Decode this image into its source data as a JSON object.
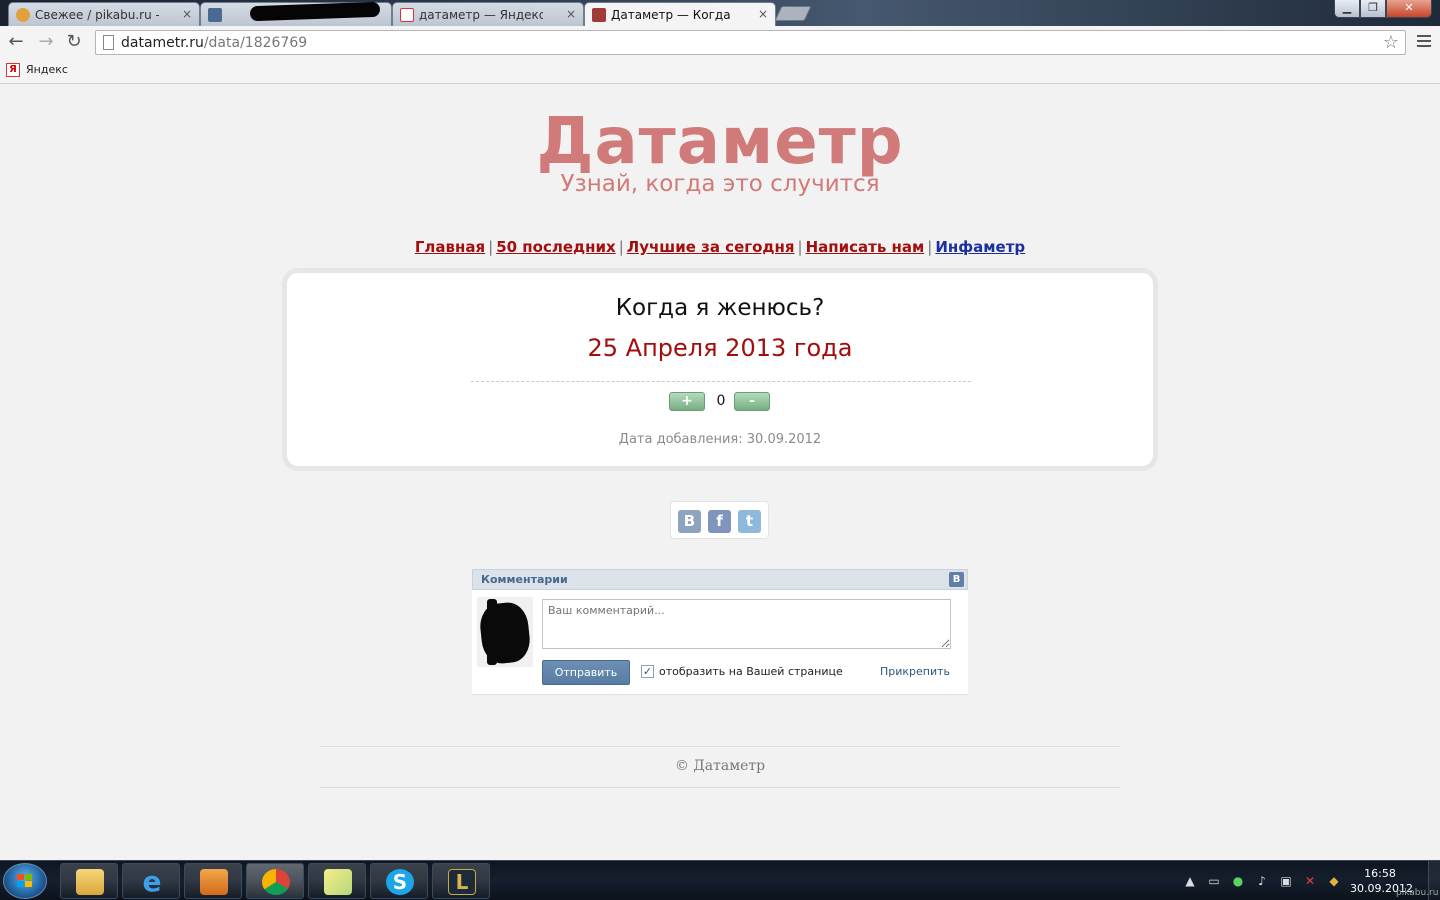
{
  "browser": {
    "tabs": [
      {
        "title": "Свежее / pikabu.ru - Все",
        "active": false
      },
      {
        "title": "",
        "active": false
      },
      {
        "title": "датаметр — Яндекс: нашл",
        "active": false
      },
      {
        "title": "Датаметр — Когда я жени",
        "active": true
      }
    ],
    "close_glyph": "×",
    "address": {
      "host": "datametr.ru",
      "path": "/data/1826769"
    },
    "bookmarks": [
      {
        "label": "Яндекс",
        "icon": "yandex-icon"
      }
    ]
  },
  "page": {
    "logo_title": "Датаметр",
    "logo_subtitle": "Узнай, когда это случится",
    "nav": [
      {
        "label": "Главная"
      },
      {
        "label": "50 последних"
      },
      {
        "label": "Лучшие за сегодня"
      },
      {
        "label": "Написать нам"
      },
      {
        "label": "Инфаметр"
      }
    ],
    "nav_separator": "|",
    "question": "Когда я женюсь?",
    "answer": "25 Апреля 2013 года",
    "vote": {
      "plus": "+",
      "count": "0",
      "minus": "-"
    },
    "added_date": "Дата добавления: 30.09.2012",
    "share": [
      "vk-icon",
      "facebook-icon",
      "twitter-icon"
    ],
    "comments": {
      "title": "Комментарии",
      "vk_badge": "В",
      "placeholder": "Ваш комментарий...",
      "send_label": "Отправить",
      "show_on_page_label": "отобразить на Вашей странице",
      "show_on_page_checked": true,
      "attach_label": "Прикрепить"
    },
    "footer": "© Датаметр"
  },
  "taskbar": {
    "apps": [
      "explorer-icon",
      "ie-icon",
      "media-player-icon",
      "chrome-icon",
      "sticky-notes-icon",
      "skype-icon",
      "league-of-legends-icon"
    ],
    "active_app": "chrome-icon",
    "tray": [
      "arrow-up-icon",
      "network-icon",
      "security-icon",
      "volume-icon",
      "no-connection-icon",
      "update-icon"
    ],
    "time": "16:58",
    "date": "30.09.2012"
  },
  "watermark": "pikabu.ru",
  "colors": {
    "logo": "#d07a79",
    "answer": "#a20d0d",
    "nav_link": "#a30f0f",
    "nav_link_blue": "#1c2fa0",
    "vk_blue": "#5f7fa5"
  }
}
